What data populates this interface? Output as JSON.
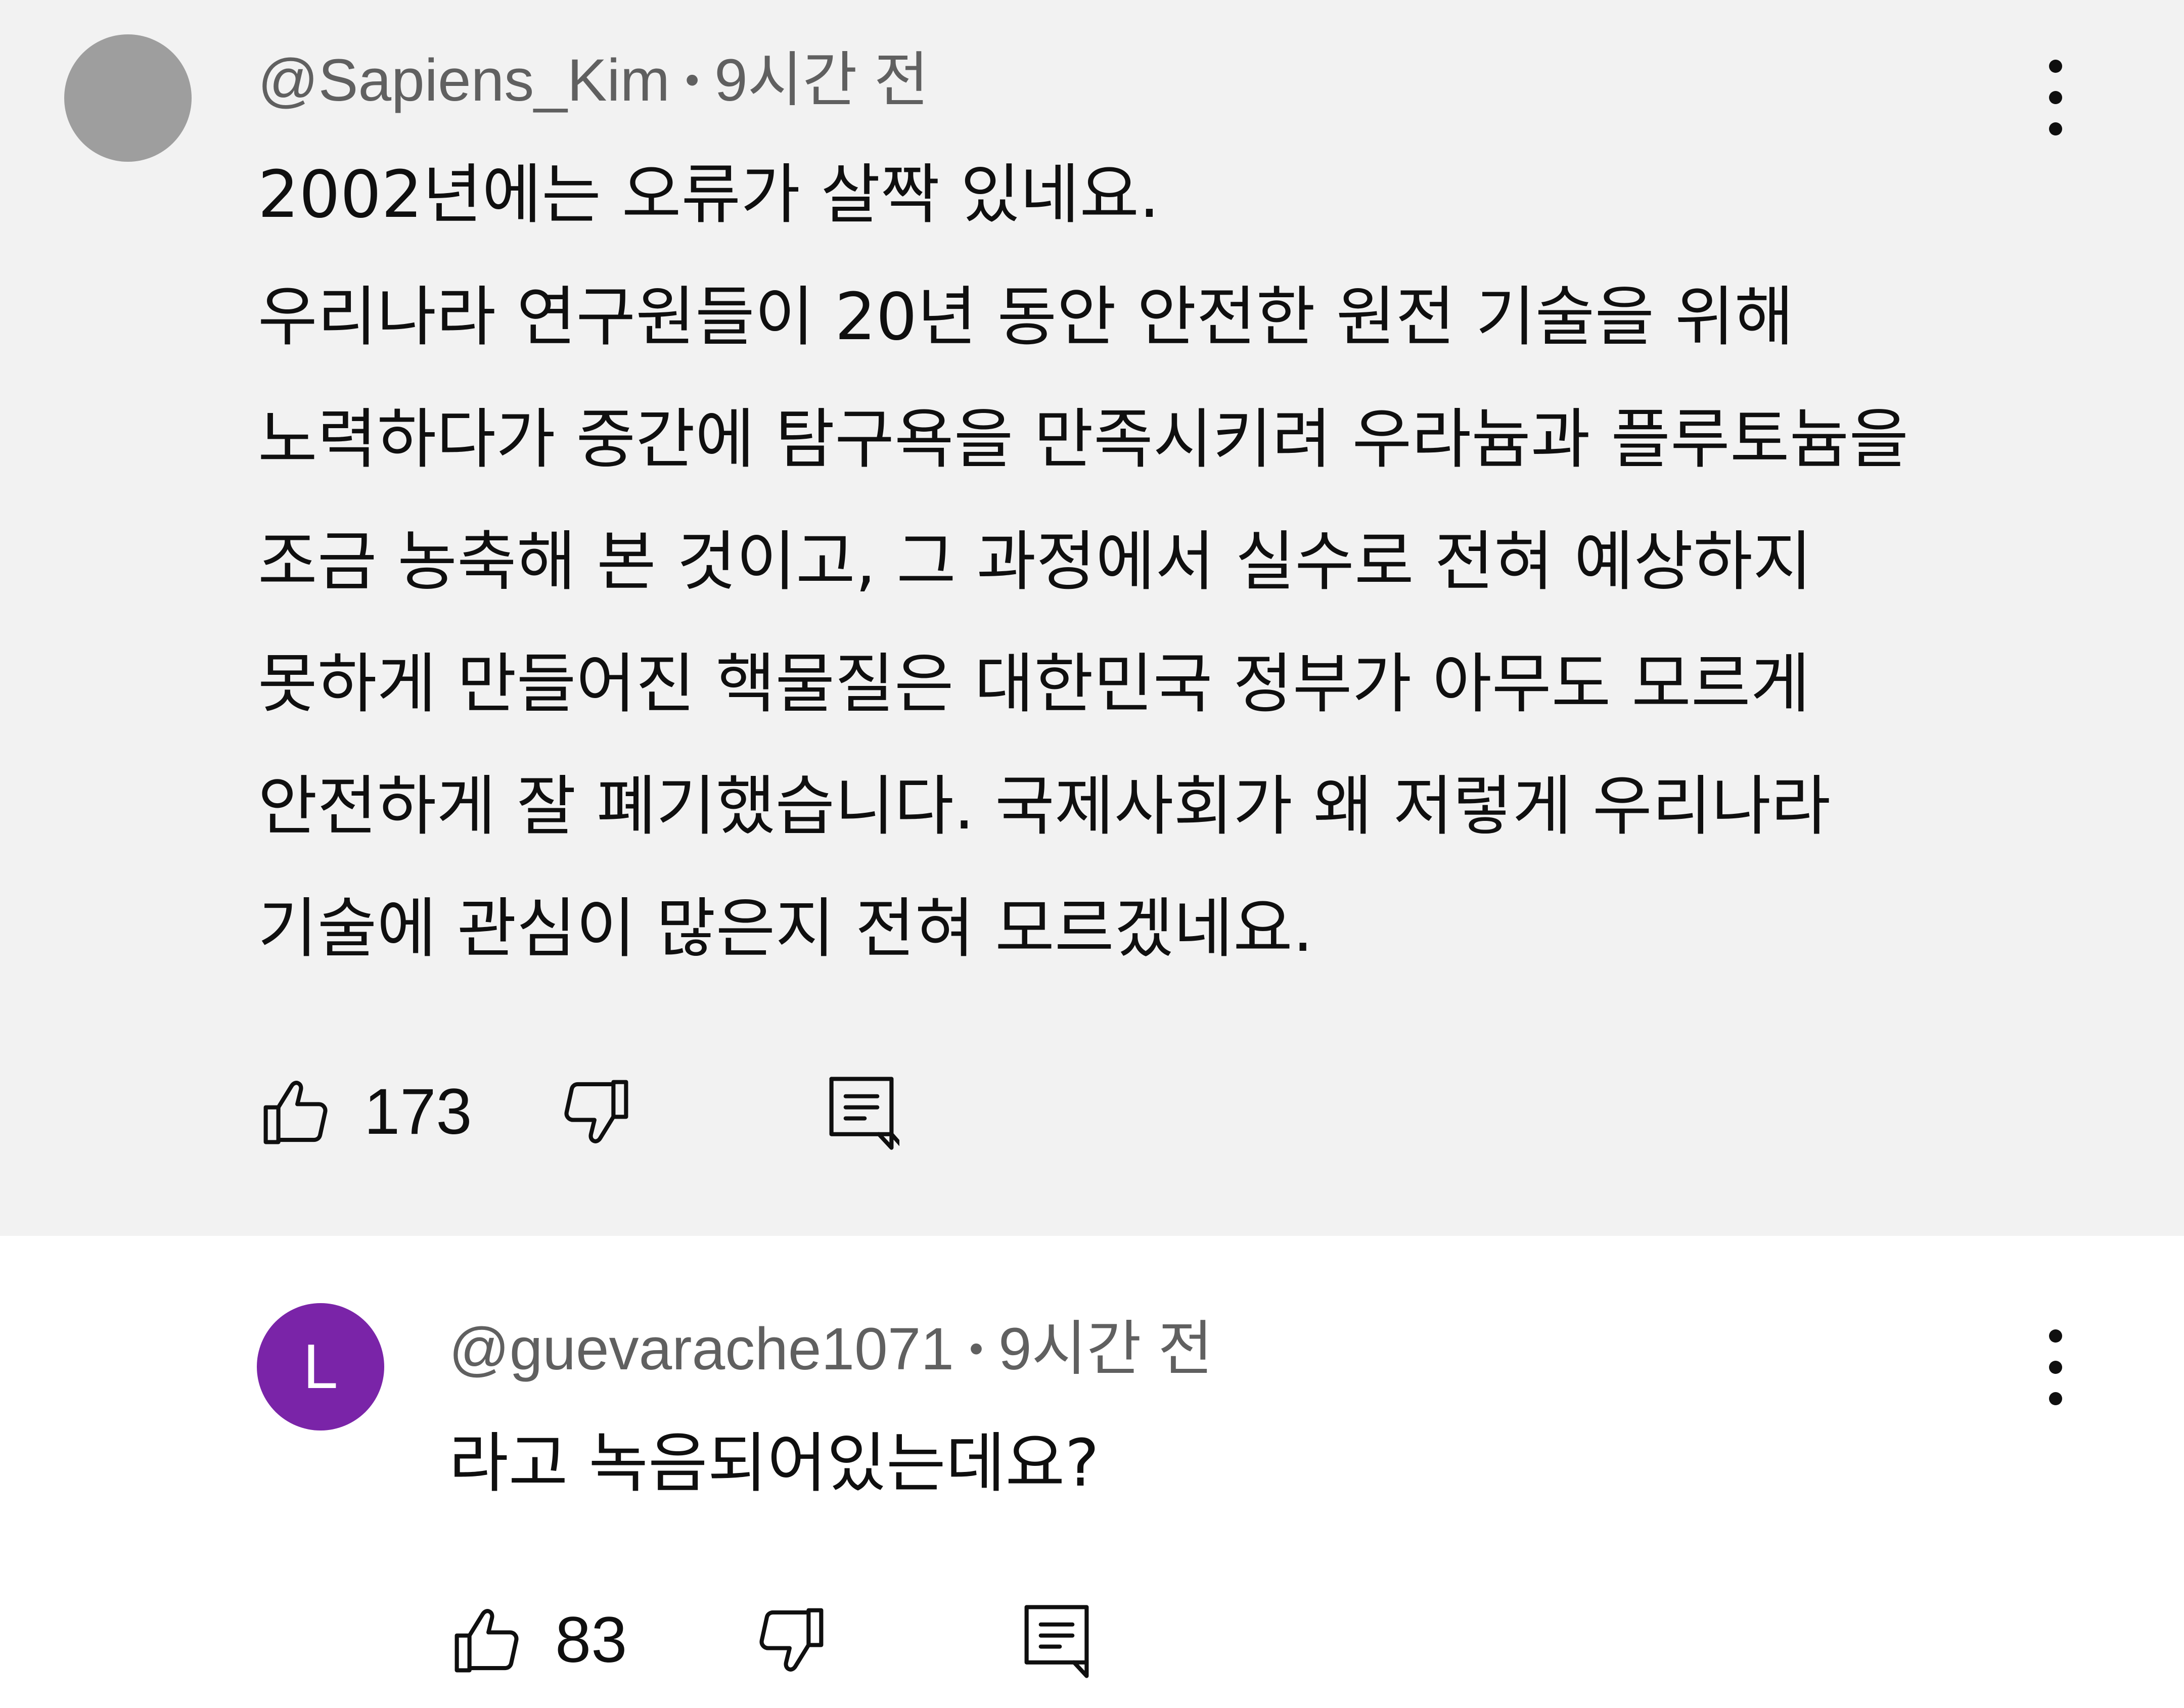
{
  "comments": [
    {
      "avatar_letter": "",
      "avatar_color": "#9e9e9e",
      "author": "@Sapiens_Kim",
      "separator": "•",
      "time": "9시간 전",
      "lines": [
        "2002년에는 오류가 살짝 있네요.",
        "우리나라 연구원들이 20년 동안 안전한 원전 기술을 위해",
        "노력하다가 중간에 탐구욕을 만족시키려 우라늄과 플루토늄을",
        "조금 농축해 본 것이고, 그 과정에서 실수로 전혀 예상하지",
        "못하게 만들어진 핵물질은 대한민국 정부가 아무도 모르게",
        "안전하게 잘 폐기했습니다. 국제사회가 왜 저렇게 우리나라",
        "기술에 관심이 많은지 전혀 모르겠네요."
      ],
      "like_count": "173",
      "icons": {
        "like": "thumbs-up-icon",
        "dislike": "thumbs-down-icon",
        "reply": "reply-comment-icon",
        "menu": "more-vertical-icon"
      }
    },
    {
      "avatar_letter": "L",
      "avatar_color": "#7a24a8",
      "author": "@guevarache1071",
      "separator": "•",
      "time": "9시간 전",
      "lines": [
        "라고 녹음되어있는데요?"
      ],
      "like_count": "83",
      "icons": {
        "like": "thumbs-up-icon",
        "dislike": "thumbs-down-icon",
        "reply": "reply-comment-icon",
        "menu": "more-vertical-icon"
      }
    }
  ],
  "colors": {
    "highlight_background": "#f2f2f2",
    "meta_text": "#606060",
    "body_text": "#0f0f0f"
  }
}
